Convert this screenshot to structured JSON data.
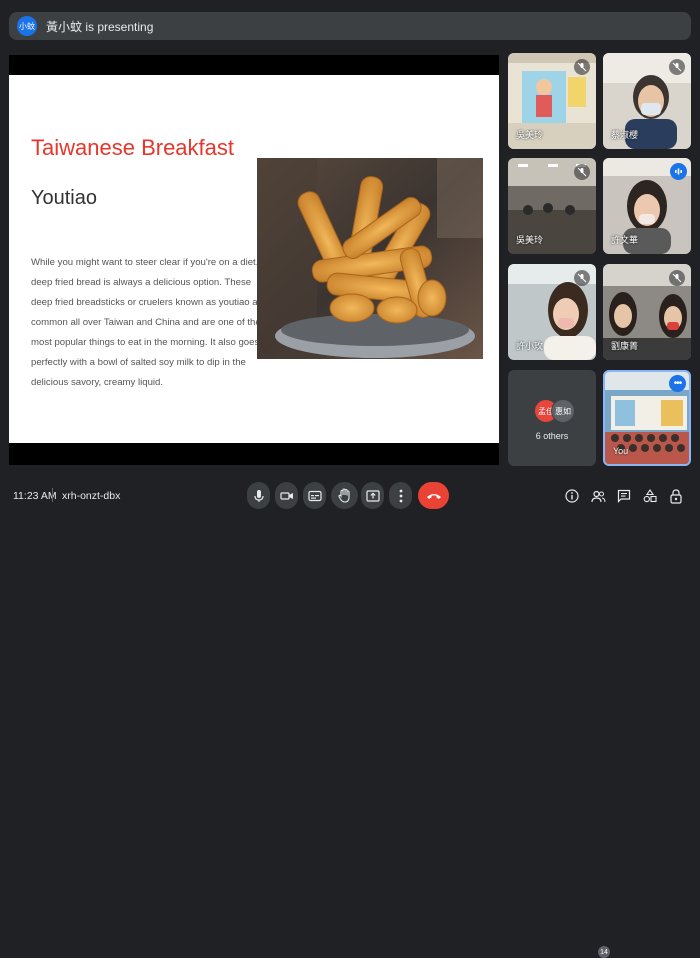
{
  "header": {
    "presenter_avatar": "小蚊",
    "presenting_text": "黃小蚊 is presenting"
  },
  "slide": {
    "title": "Taiwanese Breakfast",
    "subtitle": "Youtiao",
    "body": "While you might want to steer clear if you're on a diet, deep fried bread is always a delicious option. These deep fried breadsticks or cruelers known as youtiao are common all over Taiwan and China and are one of the most popular things to eat in the morning. It also goes perfectly with a bowl of salted soy milk to dip in the delicious savory, creamy liquid."
  },
  "participants": [
    {
      "name": "吳美玲",
      "muted": true
    },
    {
      "name": "蔡淑櫻",
      "muted": true
    },
    {
      "name": "吳美玲",
      "muted": true
    },
    {
      "name": "許文華",
      "muted": false,
      "speaking": true
    },
    {
      "name": "許小玫",
      "muted": true
    },
    {
      "name": "劉康菁",
      "muted": true
    }
  ],
  "others": {
    "avatars": [
      "孟佳",
      "惠如"
    ],
    "avatar_colors": [
      "#e8453c",
      "#5f6368"
    ],
    "label": "6 others"
  },
  "self_tile": {
    "name": "You"
  },
  "footer": {
    "time": "11:23 AM",
    "meeting_code": "xrh-onzt-dbx",
    "participant_count": "14"
  },
  "colors": {
    "accent": "#1a73e8",
    "hangup": "#ea4335",
    "slide_title": "#e8362c"
  },
  "icons": [
    "microphone-icon",
    "camera-icon",
    "captions-icon",
    "raise-hand-icon",
    "present-icon",
    "more-options-icon",
    "hangup-icon",
    "info-icon",
    "people-icon",
    "chat-icon",
    "activities-icon",
    "host-controls-icon"
  ]
}
